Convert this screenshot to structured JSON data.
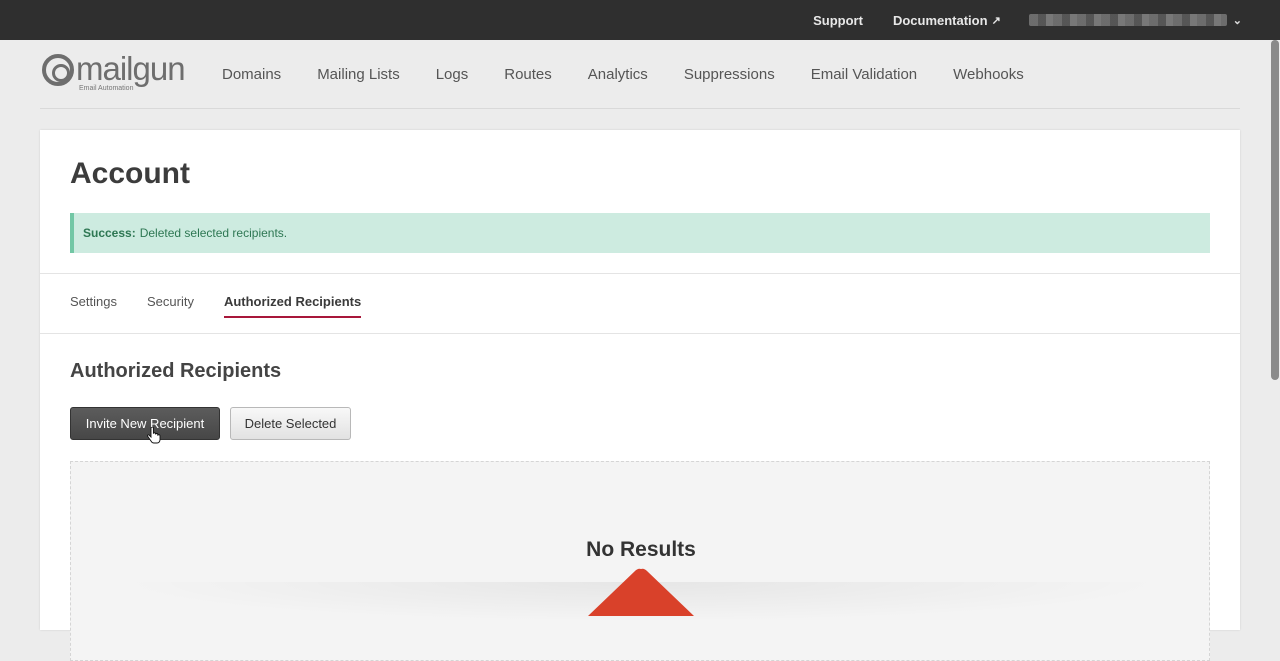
{
  "topbar": {
    "support": "Support",
    "documentation": "Documentation",
    "external_icon": "external-link-icon",
    "account_icon": "chevron-down-icon"
  },
  "logo": {
    "wordmark": "mailgun",
    "tagline": "Email Automation"
  },
  "nav": {
    "items": [
      "Domains",
      "Mailing Lists",
      "Logs",
      "Routes",
      "Analytics",
      "Suppressions",
      "Email Validation",
      "Webhooks"
    ]
  },
  "page": {
    "title": "Account",
    "alert": {
      "strong": "Success:",
      "message": "Deleted selected recipients."
    },
    "tabs": [
      {
        "label": "Settings",
        "active": false
      },
      {
        "label": "Security",
        "active": false
      },
      {
        "label": "Authorized Recipients",
        "active": true
      }
    ],
    "section_title": "Authorized Recipients",
    "buttons": {
      "invite": "Invite New Recipient",
      "delete": "Delete Selected"
    },
    "empty_state": "No Results"
  },
  "colors": {
    "topbar_bg": "#2f2f2f",
    "tab_underline": "#a8173a",
    "alert_bg": "#cdebe0",
    "alert_text": "#2e7753",
    "illustration": "#d9412a"
  }
}
